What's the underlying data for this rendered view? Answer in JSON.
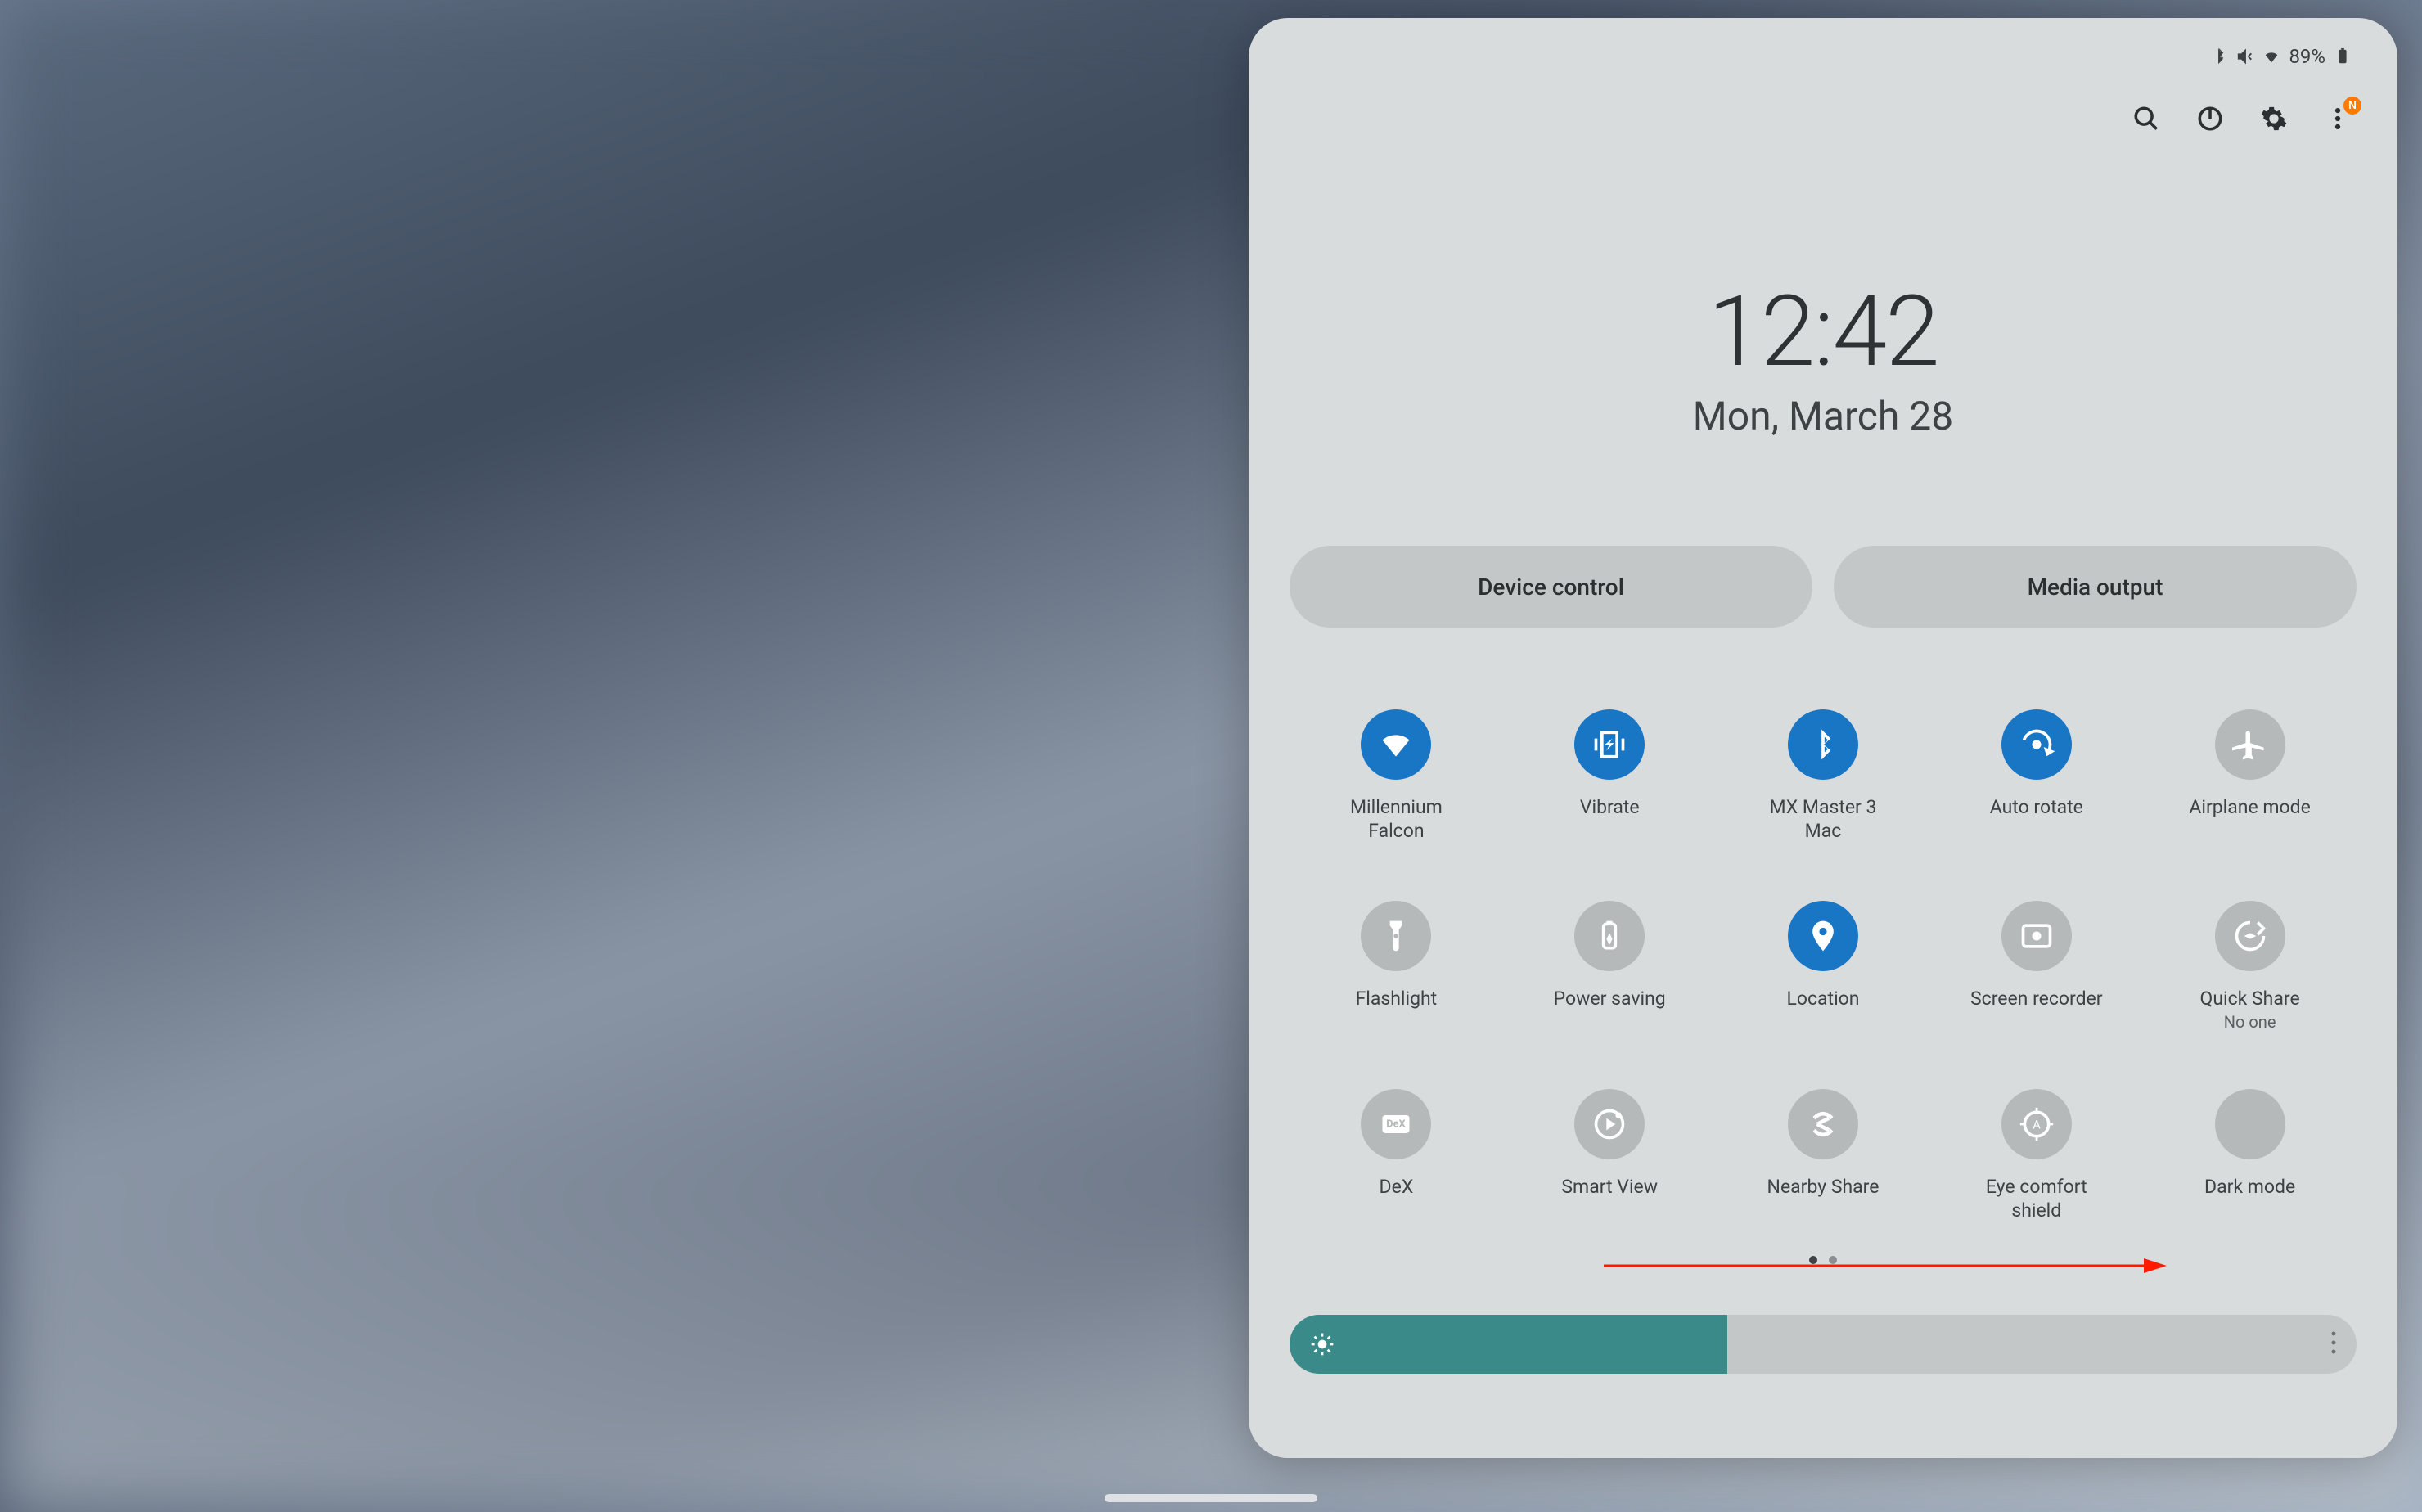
{
  "statusbar": {
    "battery_percent": "89%"
  },
  "toolbar": {
    "overflow_badge": "N"
  },
  "clock": {
    "time": "12:42",
    "date": "Mon, March 28"
  },
  "pills": {
    "device_control": "Device control",
    "media_output": "Media output"
  },
  "tiles": [
    {
      "id": "wifi",
      "label": "Millennium Falcon",
      "sublabel": "",
      "active": true,
      "icon": "wifi"
    },
    {
      "id": "vibrate",
      "label": "Vibrate",
      "sublabel": "",
      "active": true,
      "icon": "vibrate"
    },
    {
      "id": "bluetooth",
      "label": "MX Master 3 Mac",
      "sublabel": "",
      "active": true,
      "icon": "bluetooth"
    },
    {
      "id": "autorotate",
      "label": "Auto rotate",
      "sublabel": "",
      "active": true,
      "icon": "rotate"
    },
    {
      "id": "airplane",
      "label": "Airplane mode",
      "sublabel": "",
      "active": false,
      "icon": "airplane"
    },
    {
      "id": "flashlight",
      "label": "Flashlight",
      "sublabel": "",
      "active": false,
      "icon": "flashlight"
    },
    {
      "id": "powersaving",
      "label": "Power saving",
      "sublabel": "",
      "active": false,
      "icon": "battery"
    },
    {
      "id": "location",
      "label": "Location",
      "sublabel": "",
      "active": true,
      "icon": "location"
    },
    {
      "id": "screenrec",
      "label": "Screen recorder",
      "sublabel": "",
      "active": false,
      "icon": "record"
    },
    {
      "id": "quickshare",
      "label": "Quick Share",
      "sublabel": "No one",
      "active": false,
      "icon": "share"
    },
    {
      "id": "dex",
      "label": "DeX",
      "sublabel": "",
      "active": false,
      "icon": "dex"
    },
    {
      "id": "smartview",
      "label": "Smart View",
      "sublabel": "",
      "active": false,
      "icon": "cast"
    },
    {
      "id": "nearbyshare",
      "label": "Nearby Share",
      "sublabel": "",
      "active": false,
      "icon": "nearby"
    },
    {
      "id": "eyecomfort",
      "label": "Eye comfort shield",
      "sublabel": "",
      "active": false,
      "icon": "eye"
    },
    {
      "id": "darkmode",
      "label": "Dark mode",
      "sublabel": "",
      "active": false,
      "icon": "moon"
    }
  ],
  "brightness": {
    "percent": 41
  },
  "page_indicator": {
    "total": 2,
    "current": 0
  }
}
